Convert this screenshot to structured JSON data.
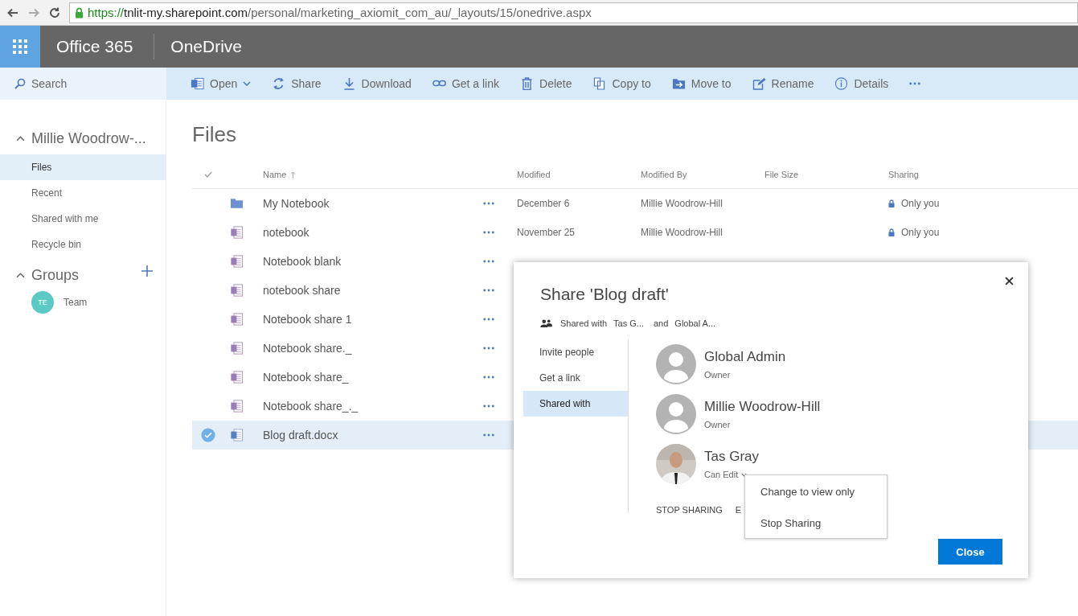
{
  "browser": {
    "url": {
      "scheme": "https://",
      "host": "tnlit-my.sharepoint.com",
      "path": "/personal/marketing_axiomit_com_au/_layouts/15/onedrive.aspx"
    }
  },
  "suite_bar": {
    "brand": "Office 365",
    "app": "OneDrive"
  },
  "search": {
    "placeholder": "Search"
  },
  "commands": [
    {
      "kind": "word",
      "label": "Open",
      "dropdown": true
    },
    {
      "kind": "share",
      "label": "Share",
      "dropdown": false
    },
    {
      "kind": "download",
      "label": "Download",
      "dropdown": false
    },
    {
      "kind": "link",
      "label": "Get a link",
      "dropdown": false
    },
    {
      "kind": "delete",
      "label": "Delete",
      "dropdown": false
    },
    {
      "kind": "copy",
      "label": "Copy to",
      "dropdown": false
    },
    {
      "kind": "move",
      "label": "Move to",
      "dropdown": false
    },
    {
      "kind": "rename",
      "label": "Rename",
      "dropdown": false
    },
    {
      "kind": "details",
      "label": "Details",
      "dropdown": false
    },
    {
      "kind": "more"
    }
  ],
  "nav": {
    "user": {
      "label": "Millie Woodrow-...",
      "expanded": true
    },
    "items": [
      {
        "label": "Files",
        "selected": true
      },
      {
        "label": "Recent",
        "selected": false
      },
      {
        "label": "Shared with me",
        "selected": false
      },
      {
        "label": "Recycle bin",
        "selected": false
      }
    ],
    "groups": {
      "label": "Groups",
      "expanded": true,
      "items": [
        {
          "initials": "TE",
          "label": "Team"
        }
      ]
    }
  },
  "page_title": "Files",
  "table": {
    "columns": [
      {
        "kind": "check"
      },
      {
        "kind": "icon"
      },
      {
        "kind": "text",
        "label": "Name",
        "sorted": true
      },
      {
        "kind": "more"
      },
      {
        "kind": "text",
        "label": "Modified",
        "sorted": false
      },
      {
        "kind": "text",
        "label": "Modified By",
        "sorted": false
      },
      {
        "kind": "text",
        "label": "File Size",
        "sorted": false
      },
      {
        "kind": "text",
        "label": "Sharing",
        "sorted": false
      }
    ],
    "rows": [
      {
        "kind": "folder",
        "name": "My Notebook",
        "selected": false,
        "modified": "December 6",
        "modified_by": "Millie Woodrow-Hill",
        "sharing": "Only you"
      },
      {
        "kind": "onenote",
        "name": "notebook",
        "selected": false,
        "modified": "November 25",
        "modified_by": "Millie Woodrow-Hill",
        "sharing": "Only you"
      },
      {
        "kind": "onenote",
        "name": "Notebook blank",
        "selected": false
      },
      {
        "kind": "onenote",
        "name": "notebook share",
        "selected": false
      },
      {
        "kind": "onenote",
        "name": "Notebook share 1",
        "selected": false
      },
      {
        "kind": "onenote",
        "name": "Notebook share._",
        "selected": false
      },
      {
        "kind": "onenote",
        "name": "Notebook share_",
        "selected": false
      },
      {
        "kind": "onenote",
        "name": "Notebook share_._",
        "selected": false
      },
      {
        "kind": "word",
        "name": "Blog draft.docx",
        "selected": true
      }
    ]
  },
  "dialog": {
    "title": "Share 'Blog draft'",
    "summary": {
      "label": "Shared with",
      "first": "Tas G...",
      "joiner": "and",
      "second": "Global A..."
    },
    "tabs": [
      {
        "label": "Invite people",
        "selected": false
      },
      {
        "label": "Get a link",
        "selected": false
      },
      {
        "label": "Shared with",
        "selected": true
      }
    ],
    "people": [
      {
        "kind": "placeholder",
        "name": "Global Admin",
        "role": "Owner",
        "role_dropdown": false
      },
      {
        "kind": "placeholder",
        "name": "Millie Woodrow-Hill",
        "role": "Owner",
        "role_dropdown": false
      },
      {
        "name": "Tas Gray",
        "role": "Can Edit",
        "role_dropdown": true
      }
    ],
    "actions": [
      "STOP SHARING",
      "E"
    ],
    "menu": [
      "Change to view only",
      "Stop Sharing"
    ],
    "close_label": "Close"
  }
}
